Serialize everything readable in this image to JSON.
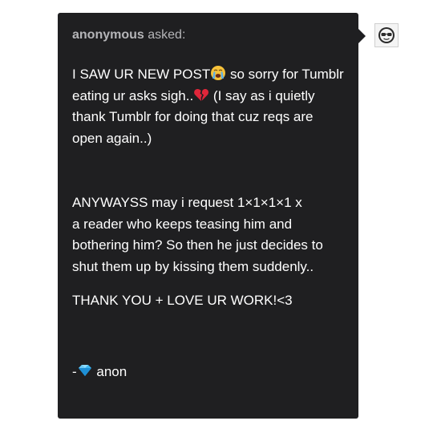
{
  "ask": {
    "asker": "anonymous",
    "asked_label": " asked:",
    "paragraph_1": {
      "part_a": "I SAW UR NEW POST",
      "emoji_a": "crying-face-emoji",
      "part_b": " so sorry for Tumblr eating ur asks sigh..",
      "emoji_b": "broken-heart-emoji",
      "part_c": " (I say as i quietly thank Tumblr for doing that cuz reqs are open again..)"
    },
    "paragraph_2": {
      "line_1": "ANYWAYSS may i request 1×1×1×1 x",
      "line_2": "a reader who keeps teasing him and bothering him? So then he just decides to shut them up by kissing them suddenly.."
    },
    "paragraph_3": "THANK YOU + LOVE UR WORK!<3",
    "signoff": {
      "prefix": "-",
      "emoji": "diamond-emoji",
      "text": " anon"
    }
  },
  "avatar": {
    "icon": "sunglasses-face-icon"
  },
  "colors": {
    "card_background": "#1f1f21",
    "body_text": "#ffffff",
    "header_text": "#b5b5b8",
    "page_background": "#ffffff"
  }
}
